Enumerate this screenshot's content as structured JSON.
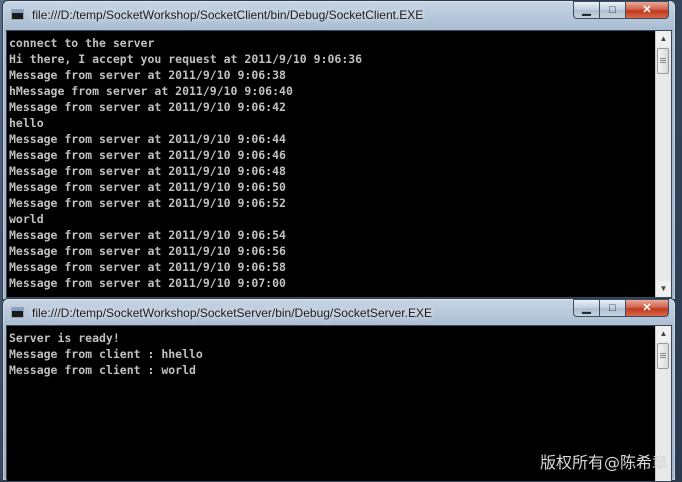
{
  "client_window": {
    "title": "file:///D:/temp/SocketWorkshop/SocketClient/bin/Debug/SocketClient.EXE",
    "controls": {
      "minimize": "▁",
      "maximize": "□",
      "close": "✕"
    },
    "lines": [
      "connect to the server",
      "Hi there, I accept you request at 2011/9/10 9:06:36",
      "Message from server at 2011/9/10 9:06:38",
      "hMessage from server at 2011/9/10 9:06:40",
      "Message from server at 2011/9/10 9:06:42",
      "hello",
      "Message from server at 2011/9/10 9:06:44",
      "Message from server at 2011/9/10 9:06:46",
      "Message from server at 2011/9/10 9:06:48",
      "Message from server at 2011/9/10 9:06:50",
      "Message from server at 2011/9/10 9:06:52",
      "world",
      "Message from server at 2011/9/10 9:06:54",
      "Message from server at 2011/9/10 9:06:56",
      "Message from server at 2011/9/10 9:06:58",
      "Message from server at 2011/9/10 9:07:00"
    ]
  },
  "server_window": {
    "title": "file:///D:/temp/SocketWorkshop/SocketServer/bin/Debug/SocketServer.EXE",
    "controls": {
      "minimize": "▁",
      "maximize": "□",
      "close": "✕"
    },
    "lines": [
      "Server is ready!",
      "Message from client : hhello",
      "Message from client : world"
    ]
  },
  "scrollbar": {
    "up": "▲",
    "down": "▼"
  },
  "watermark": "版权所有@陈希章",
  "colors": {
    "console_bg": "#000000",
    "console_text": "#c0c0c0",
    "close_button": "#c0391f"
  }
}
